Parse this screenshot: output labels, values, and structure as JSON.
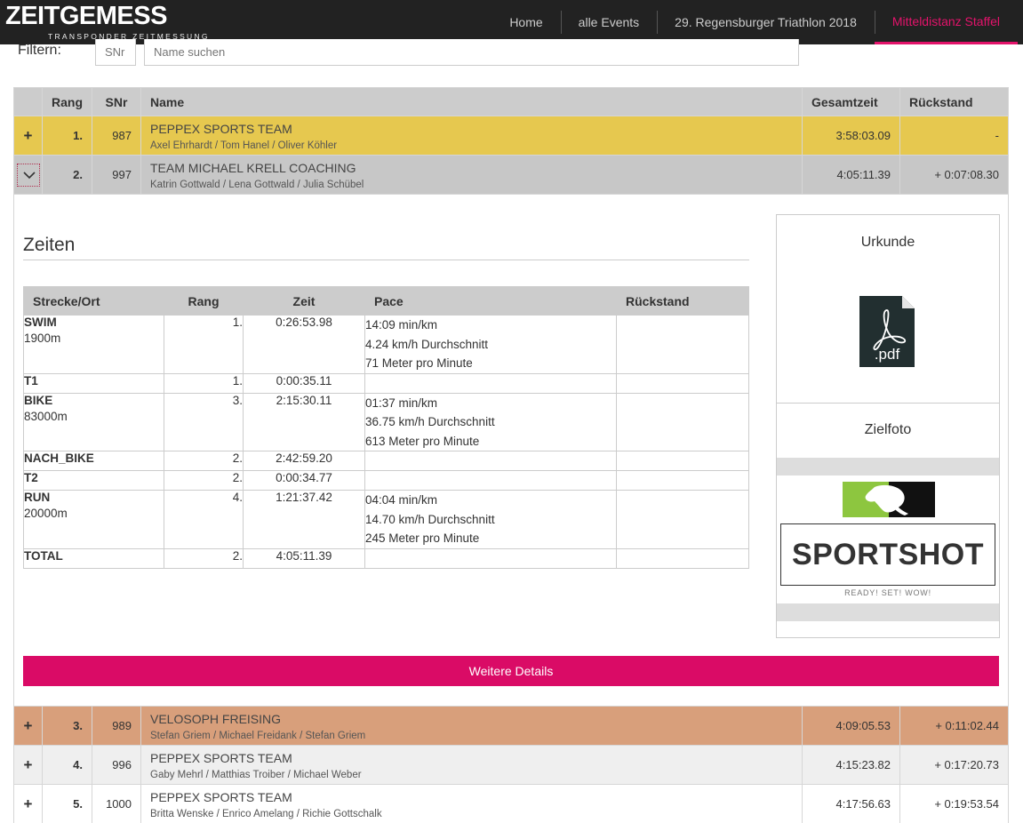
{
  "brand": {
    "logo_text": "ZEITGEMESS",
    "logo_sub": "TRANSPONDER ZEITMESSUNG"
  },
  "nav": [
    {
      "label": "Home"
    },
    {
      "label": "alle Events"
    },
    {
      "label": "29. Regensburger Triathlon 2018"
    },
    {
      "label": "Mitteldistanz Staffel"
    }
  ],
  "filter": {
    "label": "Filtern:",
    "snr_placeholder": "SNr",
    "name_placeholder": "Name suchen"
  },
  "results": {
    "headers": {
      "rang": "Rang",
      "snr": "SNr",
      "name": "Name",
      "gesamtzeit": "Gesamtzeit",
      "rueckstand": "Rückstand"
    },
    "rows": [
      {
        "expander": "+",
        "rang": "1.",
        "snr": "987",
        "team": "PEPPEX SPORTS TEAM",
        "members": "Axel Ehrhardt / Tom Hanel / Oliver Köhler",
        "gesamtzeit": "3:58:03.09",
        "rueckstand": "-"
      },
      {
        "rang": "2.",
        "snr": "997",
        "team": "TEAM MICHAEL KRELL COACHING",
        "members": "Katrin Gottwald / Lena Gottwald / Julia Schübel",
        "gesamtzeit": "4:05:11.39",
        "rueckstand": "+ 0:07:08.30"
      },
      {
        "expander": "+",
        "rang": "3.",
        "snr": "989",
        "team": "VELOSOPH FREISING",
        "members": "Stefan Griem / Michael Freidank / Stefan Griem",
        "gesamtzeit": "4:09:05.53",
        "rueckstand": "+ 0:11:02.44"
      },
      {
        "expander": "+",
        "rang": "4.",
        "snr": "996",
        "team": "PEPPEX SPORTS TEAM",
        "members": "Gaby Mehrl / Matthias Troiber / Michael Weber",
        "gesamtzeit": "4:15:23.82",
        "rueckstand": "+ 0:17:20.73"
      },
      {
        "expander": "+",
        "rang": "5.",
        "snr": "1000",
        "team": "PEPPEX SPORTS TEAM",
        "members": "Britta Wenske / Enrico Amelang / Richie Gottschalk",
        "gesamtzeit": "4:17:56.63",
        "rueckstand": "+ 0:19:53.54"
      }
    ]
  },
  "detail": {
    "zeiten_title": "Zeiten",
    "headers": {
      "strecke": "Strecke/Ort",
      "rang": "Rang",
      "zeit": "Zeit",
      "pace": "Pace",
      "rueckstand": "Rückstand"
    },
    "splits": [
      {
        "name": "SWIM",
        "dist": "1900m",
        "rang": "1.",
        "zeit": "0:26:53.98",
        "pace": [
          "14:09 min/km",
          "4.24 km/h Durchschnitt",
          "71 Meter pro Minute"
        ],
        "rueckstand": ""
      },
      {
        "name": "T1",
        "rang": "1.",
        "zeit": "0:00:35.11",
        "rueckstand": ""
      },
      {
        "name": "BIKE",
        "dist": "83000m",
        "rang": "3.",
        "zeit": "2:15:30.11",
        "pace": [
          "01:37 min/km",
          "36.75 km/h Durchschnitt",
          "613 Meter pro Minute"
        ],
        "rueckstand": ""
      },
      {
        "name": "NACH_BIKE",
        "rang": "2.",
        "zeit": "2:42:59.20",
        "rueckstand": ""
      },
      {
        "name": "T2",
        "rang": "2.",
        "zeit": "0:00:34.77",
        "rueckstand": ""
      },
      {
        "name": "RUN",
        "dist": "20000m",
        "rang": "4.",
        "zeit": "1:21:37.42",
        "pace": [
          "04:04 min/km",
          "14.70 km/h Durchschnitt",
          "245 Meter pro Minute"
        ],
        "rueckstand": ""
      },
      {
        "name": "TOTAL",
        "rang": "2.",
        "zeit": "4:05:11.39",
        "rueckstand": ""
      }
    ],
    "urkunde_title": "Urkunde",
    "pdf_label": ".pdf",
    "zielfoto_title": "Zielfoto",
    "sportshot_logo": "SPORTSHOT",
    "sportshot_slogan": "READY! SET! WOW!",
    "details_button": "Weitere Details"
  },
  "colors": {
    "accent": "#e3136b",
    "button": "#da0b66",
    "gold": "#e6c84f",
    "silver": "#c7c7c7",
    "bronze": "#d89f7b",
    "sportshot_green": "#8dc63f"
  }
}
